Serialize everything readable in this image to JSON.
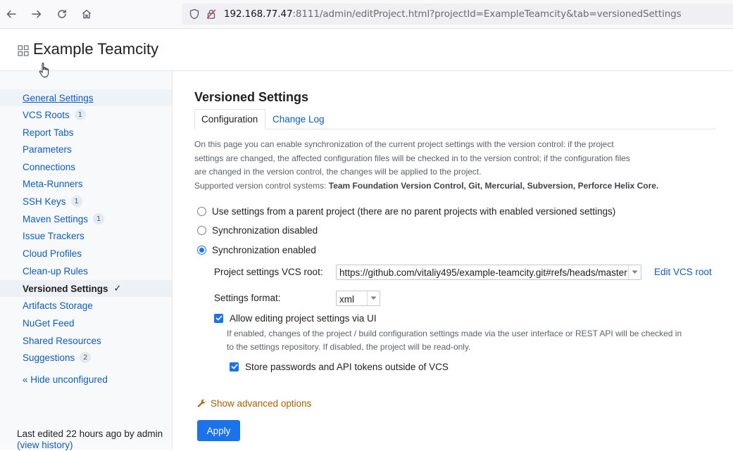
{
  "browser": {
    "url_host": "192.168.77.47",
    "url_rest": ":8111/admin/editProject.html?projectId=ExampleTeamcity&tab=versionedSettings"
  },
  "header": {
    "project_title": "Example Teamcity"
  },
  "sidebar": {
    "items": [
      {
        "label": "General Settings",
        "badge": ""
      },
      {
        "label": "VCS Roots",
        "badge": "1"
      },
      {
        "label": "Report Tabs",
        "badge": ""
      },
      {
        "label": "Parameters",
        "badge": ""
      },
      {
        "label": "Connections",
        "badge": ""
      },
      {
        "label": "Meta-Runners",
        "badge": ""
      },
      {
        "label": "SSH Keys",
        "badge": "1"
      },
      {
        "label": "Maven Settings",
        "badge": "1"
      },
      {
        "label": "Issue Trackers",
        "badge": ""
      },
      {
        "label": "Cloud Profiles",
        "badge": ""
      },
      {
        "label": "Clean-up Rules",
        "badge": ""
      },
      {
        "label": "Versioned Settings",
        "badge": "",
        "check": "✓"
      },
      {
        "label": "Artifacts Storage",
        "badge": ""
      },
      {
        "label": "NuGet Feed",
        "badge": ""
      },
      {
        "label": "Shared Resources",
        "badge": ""
      },
      {
        "label": "Suggestions",
        "badge": "2"
      }
    ],
    "hide_unconfigured": "« Hide unconfigured",
    "last_edited_prefix": "Last edited",
    "last_edited_time": "22 hours ago",
    "last_edited_by": "by admin",
    "view_history": "(view history)"
  },
  "main": {
    "title": "Versioned Settings",
    "tabs": [
      {
        "label": "Configuration",
        "active": true
      },
      {
        "label": "Change Log",
        "active": false
      }
    ],
    "description_line1": "On this page you can enable synchronization of the current project settings with the version control: if the project",
    "description_line2": "settings are changed, the affected configuration files will be checked in to the version control; if the configuration files",
    "description_line3": "are changed in the version control, the changes will be applied to the project.",
    "supported_prefix": "Supported version control systems:",
    "supported_systems": "Team Foundation Version Control, Git, Mercurial, Subversion, Perforce Helix Core.",
    "radio_options": [
      {
        "label": "Use settings from a parent project (there are no parent projects with enabled versioned settings)",
        "checked": false
      },
      {
        "label": "Synchronization disabled",
        "checked": false
      },
      {
        "label": "Synchronization enabled",
        "checked": true
      }
    ],
    "vcs_root_label": "Project settings VCS root:",
    "vcs_root_value": "https://github.com/vitaliy495/example-teamcity.git#refs/heads/master",
    "edit_vcs_root": "Edit VCS root",
    "settings_format_label": "Settings format:",
    "settings_format_value": "xml",
    "allow_editing_label": "Allow editing project settings via UI",
    "allow_editing_checked": true,
    "hint_line1": "If enabled, changes of the project / build configuration settings made via the user interface or REST API will be checked in",
    "hint_line2": "to the settings repository. If disabled, the project will be read-only.",
    "store_passwords_label": "Store passwords and API tokens outside of VCS",
    "store_passwords_checked": true,
    "show_advanced": "Show advanced options",
    "apply_label": "Apply"
  },
  "colors": {
    "link": "#0f5cb8",
    "accent": "#1a73e8",
    "advanced": "#a85f00"
  },
  "icons": [
    "back-icon",
    "forward-icon",
    "reload-icon",
    "home-icon",
    "shield-icon",
    "insecure-lock-icon",
    "project-grid-icon",
    "hand-cursor-icon",
    "wrench-icon",
    "check-icon",
    "dropdown-arrow-icon"
  ]
}
